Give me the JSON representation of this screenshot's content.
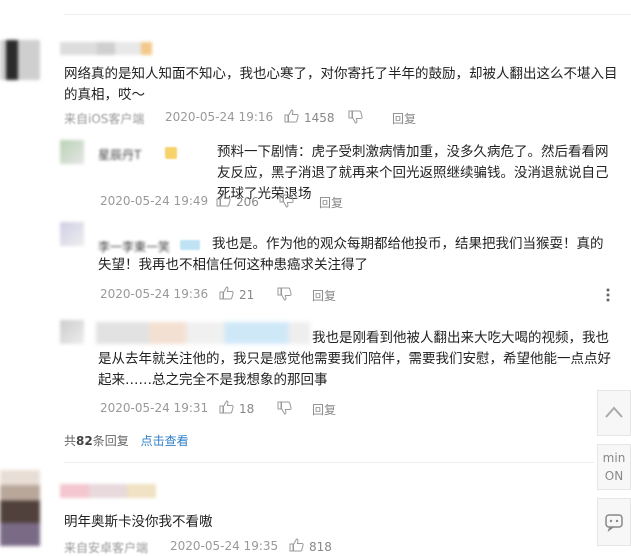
{
  "comments": [
    {
      "text": "网络真的是知人知面不知心，我也心寒了，对你寄托了半年的鼓励，却被人翻出这么不堪入目的真相，哎～",
      "source": "来自iOS客户端",
      "time": "2020-05-24 19:16",
      "likes": "1458",
      "reply_label": "回复"
    }
  ],
  "replies": [
    {
      "name": "星辰丹T",
      "text": "预料一下剧情：虎子受刺激病情加重，没多久病危了。然后看看网友反应，黑子消退了就再来个回光返照继续骗钱。没消退就说自己死球了光荣退场",
      "time": "2020-05-24 19:49",
      "likes": "206",
      "reply_label": "回复"
    },
    {
      "name": "李一李東一笑",
      "text": "我也是。作为他的观众每期都给他投币，结果把我们当猴耍！真的失望！我再也不相信任何这种患癌求关注得了",
      "time": "2020-05-24 19:36",
      "likes": "21",
      "reply_label": "回复"
    },
    {
      "text": "我也是刚看到他被人翻出来大吃大喝的视频，我也是从去年就关注他的，我只是感觉他需要我们陪伴，需要我们安慰，希望他能一点点好起来……总之完全不是我想象的那回事",
      "time": "2020-05-24 19:31",
      "likes": "18",
      "reply_label": "回复"
    }
  ],
  "reply_summary": {
    "prefix": "共",
    "count": "82",
    "suffix": "条回复",
    "view_link": "点击查看"
  },
  "comment2": {
    "text": "明年奥斯卡没你我不看嗷",
    "source": "来自安卓客户端",
    "time": "2020-05-24 19:35",
    "likes": "818"
  },
  "side": {
    "mini_label_1": "min",
    "mini_label_2": "ON"
  },
  "icons": {
    "like": "thumbs-up-icon",
    "dislike": "thumbs-down-icon",
    "more": "more-vertical-icon",
    "up": "chevron-up-icon",
    "support": "support-icon"
  }
}
